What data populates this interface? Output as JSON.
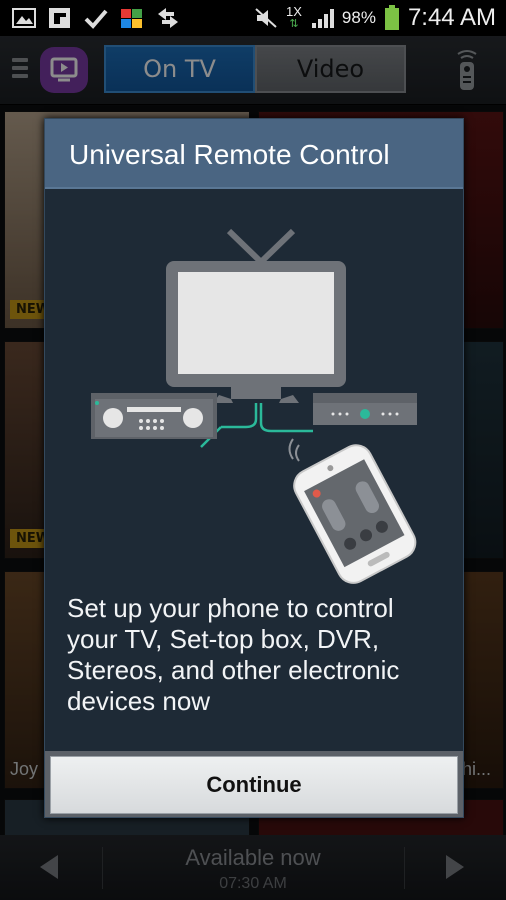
{
  "status_bar": {
    "network_type": "1X",
    "battery_percent": "98%",
    "time": "7:44 AM",
    "icons": [
      "gallery-icon",
      "flipboard-icon",
      "check-icon",
      "store-icon",
      "sync-icon",
      "mute-icon",
      "signal-icon",
      "battery-icon"
    ]
  },
  "app_bar": {
    "tabs": [
      {
        "label": "On TV",
        "selected": true
      },
      {
        "label": "Video",
        "selected": false
      }
    ],
    "icons": [
      "menu-icon",
      "app-logo-icon",
      "remote-icon"
    ]
  },
  "background": {
    "badges": [
      "NEW",
      "NEW"
    ],
    "tile_labels": [
      "Joy",
      "hi..."
    ]
  },
  "bottom_bar": {
    "title": "Available now",
    "time": "07:30 AM"
  },
  "dialog": {
    "title": "Universal Remote Control",
    "body": "Set up your phone to control your TV, Set-top box, DVR, Stereos, and other electronic devices now",
    "continue_label": "Continue",
    "colors": {
      "header": "#4a6582",
      "body": "#1e2a36",
      "accent": "#2bb99a"
    }
  }
}
